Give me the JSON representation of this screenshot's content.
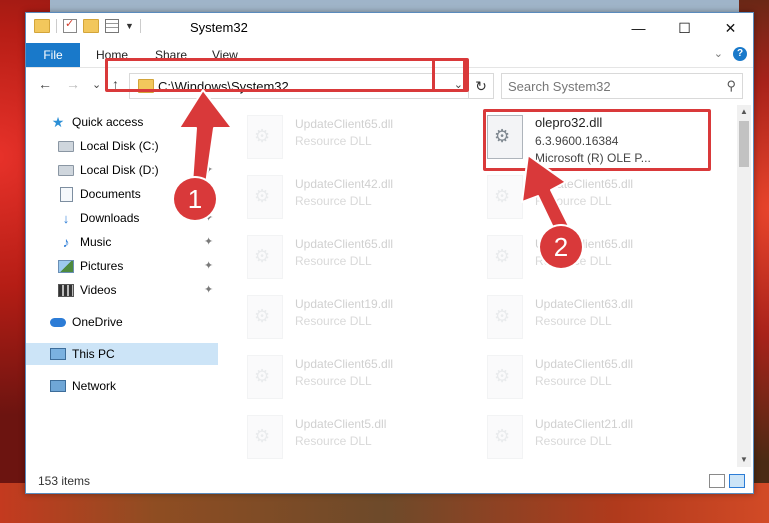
{
  "window": {
    "title": "System32",
    "caption": {
      "minimize": "—",
      "maximize": "☐",
      "close": "✕"
    }
  },
  "ribbon": {
    "file": "File",
    "tabs": [
      "Home",
      "Share",
      "View"
    ],
    "help": "?",
    "expand": "⌄"
  },
  "navigation": {
    "back": "←",
    "forward": "→",
    "recent": "⌄",
    "up": "↑",
    "address": "C:\\Windows\\System32",
    "address_dropdown": "⌄",
    "refresh": "↻",
    "search_placeholder": "Search System32",
    "search_icon": "⚲"
  },
  "sidebar": {
    "items": [
      {
        "label": "Quick access",
        "icon": "star-icon"
      },
      {
        "label": "Local Disk (C:)",
        "icon": "drive-icon",
        "pinned": true
      },
      {
        "label": "Local Disk (D:)",
        "icon": "drive-icon",
        "pinned": true
      },
      {
        "label": "Documents",
        "icon": "documents-icon",
        "pinned": true
      },
      {
        "label": "Downloads",
        "icon": "downloads-icon",
        "pinned": true
      },
      {
        "label": "Music",
        "icon": "music-icon",
        "pinned": true
      },
      {
        "label": "Pictures",
        "icon": "pictures-icon",
        "pinned": true
      },
      {
        "label": "Videos",
        "icon": "videos-icon",
        "pinned": true
      },
      {
        "label": "OneDrive",
        "icon": "onedrive-icon"
      },
      {
        "label": "This PC",
        "icon": "this-pc-icon",
        "selected": true
      },
      {
        "label": "Network",
        "icon": "network-icon"
      }
    ],
    "pin_glyph": "📌"
  },
  "files": {
    "selected": {
      "name": "olepro32.dll",
      "version": "6.3.9600.16384",
      "description": "Microsoft (R) OLE P..."
    },
    "left_column": [
      {
        "name": "UpdateClient65.dll",
        "type": "Resource DLL"
      },
      {
        "name": "UpdateClient42.dll",
        "type": "Resource DLL"
      },
      {
        "name": "UpdateClient65.dll",
        "type": "Resource DLL"
      },
      {
        "name": "UpdateClient19.dll",
        "type": "Resource DLL"
      },
      {
        "name": "UpdateClient65.dll",
        "type": "Resource DLL"
      },
      {
        "name": "UpdateClient5.dll",
        "type": "Resource DLL"
      }
    ],
    "right_column": [
      {
        "name": "UpdateClient65.dll",
        "type": "Resource DLL"
      },
      {
        "name": "UpdateClient65.dll",
        "type": "Resource DLL"
      },
      {
        "name": "UpdateClient63.dll",
        "type": "Resource DLL"
      },
      {
        "name": "UpdateClient65.dll",
        "type": "Resource DLL"
      },
      {
        "name": "UpdateClient21.dll",
        "type": "Resource DLL"
      }
    ]
  },
  "status": {
    "item_count": "153 items"
  },
  "annotations": {
    "step1": "1",
    "step2": "2",
    "color": "#d9393a"
  }
}
